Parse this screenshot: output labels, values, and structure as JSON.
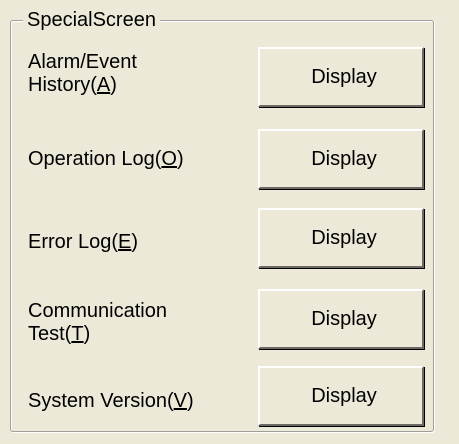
{
  "group": {
    "title": "SpecialScreen"
  },
  "rows": [
    {
      "label_line1": "Alarm/Event",
      "label_line2_pre": "History(",
      "label_line2_key": "A",
      "label_line2_post": ")",
      "button_label": "Display"
    },
    {
      "label_pre": "Operation Log(",
      "label_key": "O",
      "label_post": ")",
      "button_label": "Display"
    },
    {
      "label_pre": "Error Log(",
      "label_key": "E",
      "label_post": ")",
      "button_label": "Display"
    },
    {
      "label_line1": "Communication",
      "label_line2_pre": "Test(",
      "label_line2_key": "T",
      "label_line2_post": ")",
      "button_label": "Display"
    },
    {
      "label_pre": "System Version(",
      "label_key": "V",
      "label_post": ")",
      "button_label": "Display"
    }
  ]
}
